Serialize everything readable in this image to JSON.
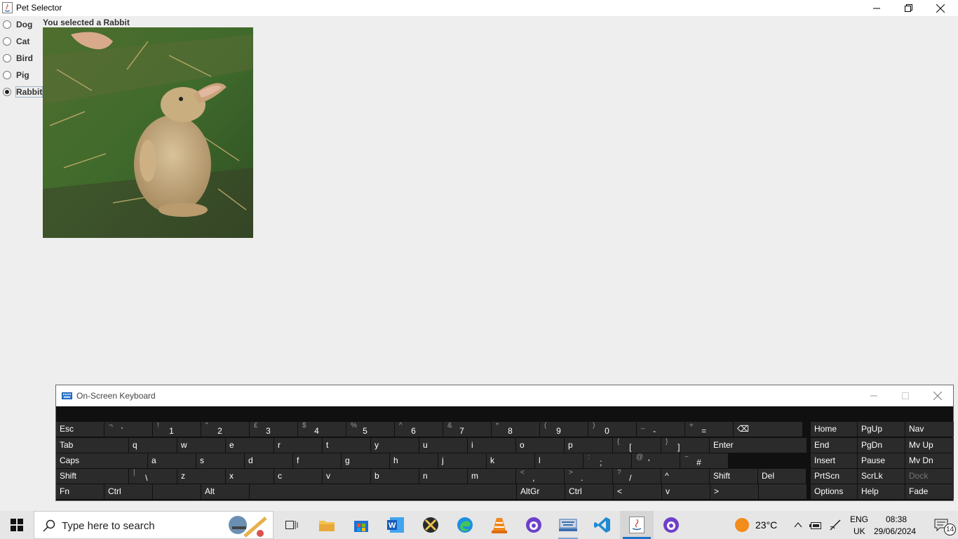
{
  "window": {
    "title": "Pet Selector",
    "selected_text": "You selected a Rabbit"
  },
  "pets": {
    "options": [
      {
        "label": "Dog",
        "selected": false
      },
      {
        "label": "Cat",
        "selected": false
      },
      {
        "label": "Bird",
        "selected": false
      },
      {
        "label": "Pig",
        "selected": false
      },
      {
        "label": "Rabbit",
        "selected": true
      }
    ]
  },
  "osk": {
    "title": "On-Screen Keyboard",
    "rows": [
      [
        {
          "label": "Esc"
        },
        {
          "top": "¬",
          "main": "`"
        },
        {
          "top": "!",
          "main": "1"
        },
        {
          "top": "\"",
          "main": "2"
        },
        {
          "top": "£",
          "main": "3"
        },
        {
          "top": "$",
          "main": "4"
        },
        {
          "top": "%",
          "main": "5"
        },
        {
          "top": "^",
          "main": "6"
        },
        {
          "top": "&",
          "main": "7"
        },
        {
          "top": "*",
          "main": "8"
        },
        {
          "top": "(",
          "main": "9"
        },
        {
          "top": ")",
          "main": "0"
        },
        {
          "top": "_",
          "main": "-"
        },
        {
          "top": "+",
          "main": "="
        },
        {
          "label": "⌫"
        }
      ],
      [
        {
          "label": "Tab"
        },
        {
          "label": "q"
        },
        {
          "label": "w"
        },
        {
          "label": "e"
        },
        {
          "label": "r"
        },
        {
          "label": "t"
        },
        {
          "label": "y"
        },
        {
          "label": "u"
        },
        {
          "label": "i"
        },
        {
          "label": "o"
        },
        {
          "label": "p"
        },
        {
          "top": "{",
          "main": "["
        },
        {
          "top": "}",
          "main": "]"
        },
        {
          "label": "Enter"
        }
      ],
      [
        {
          "label": "Caps"
        },
        {
          "label": "a"
        },
        {
          "label": "s"
        },
        {
          "label": "d"
        },
        {
          "label": "f"
        },
        {
          "label": "g"
        },
        {
          "label": "h"
        },
        {
          "label": "j"
        },
        {
          "label": "k"
        },
        {
          "label": "l"
        },
        {
          "top": ":",
          "main": ";"
        },
        {
          "top": "@",
          "main": "'"
        },
        {
          "top": "~",
          "main": "#"
        }
      ],
      [
        {
          "label": "Shift"
        },
        {
          "top": "|",
          "main": "\\"
        },
        {
          "label": "z"
        },
        {
          "label": "x"
        },
        {
          "label": "c"
        },
        {
          "label": "v"
        },
        {
          "label": "b"
        },
        {
          "label": "n"
        },
        {
          "label": "m"
        },
        {
          "top": "<",
          "main": ","
        },
        {
          "top": ">",
          "main": "."
        },
        {
          "top": "?",
          "main": "/"
        },
        {
          "label": "^"
        },
        {
          "label": "Shift"
        },
        {
          "label": "Del"
        }
      ],
      [
        {
          "label": "Fn"
        },
        {
          "label": "Ctrl"
        },
        {
          "label": ""
        },
        {
          "label": "Alt"
        },
        {
          "label": ""
        },
        {
          "label": "AltGr"
        },
        {
          "label": "Ctrl"
        },
        {
          "label": "<"
        },
        {
          "label": "v"
        },
        {
          "label": ">"
        },
        {
          "label": ""
        }
      ]
    ],
    "nav": [
      [
        "Home",
        "PgUp",
        "Nav"
      ],
      [
        "End",
        "PgDn",
        "Mv Up"
      ],
      [
        "Insert",
        "Pause",
        "Mv Dn"
      ],
      [
        "PrtScn",
        "ScrLk",
        "Dock"
      ],
      [
        "Options",
        "Help",
        "Fade"
      ]
    ]
  },
  "taskbar": {
    "search_placeholder": "Type here to search",
    "weather": "23°C",
    "lang_line1": "ENG",
    "lang_line2": "UK",
    "time": "08:38",
    "date": "29/06/2024",
    "notifications": "14"
  }
}
